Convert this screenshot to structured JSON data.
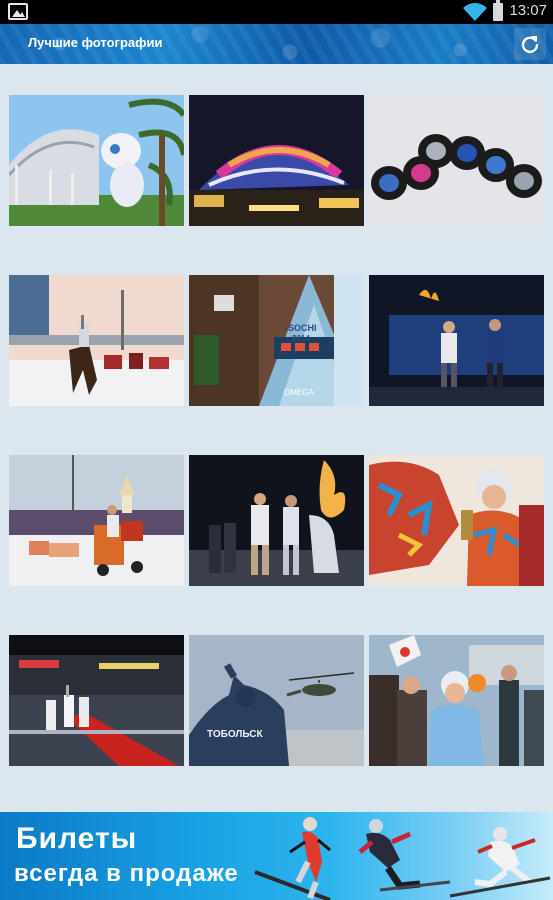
{
  "status_bar": {
    "time": "13:07",
    "left_icon": "gallery-icon",
    "icons": [
      "wifi-icon",
      "battery-icon"
    ]
  },
  "action_bar": {
    "title": "Лучшие фотографии",
    "refresh_icon": "refresh-icon"
  },
  "photos": [
    {
      "subject": "mascot-statue-photo"
    },
    {
      "subject": "stadium-night-photo"
    },
    {
      "subject": "hockey-pucks-photo"
    },
    {
      "subject": "horse-race-torch-photo"
    },
    {
      "subject": "sochi-countdown-clock-photo"
    },
    {
      "subject": "torch-stage-photo"
    },
    {
      "subject": "dog-sled-torch-photo"
    },
    {
      "subject": "torch-lighting-photo"
    },
    {
      "subject": "torchbearer-crowd-photo"
    },
    {
      "subject": "arena-red-carpet-photo"
    },
    {
      "subject": "helicopter-tobolsk-photo"
    },
    {
      "subject": "snow-maiden-crowd-photo"
    }
  ],
  "photo_texts": {
    "tobolsk": "ТОБОЛЬСК",
    "sochi_logo_line1": "SOCHI",
    "sochi_logo_line2": "2014",
    "omega": "OMEGA"
  },
  "banner": {
    "line1": "Билеты",
    "line2": "всегда в продаже"
  },
  "colors": {
    "background": "#dbe6ef",
    "action_bar": "#1467b5",
    "banner": "#19a0e3"
  }
}
